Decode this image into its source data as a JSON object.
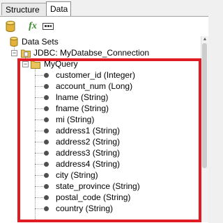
{
  "tabs": [
    {
      "label": "Structure",
      "active": false
    },
    {
      "label": "Data",
      "active": true
    }
  ],
  "toolbar": {
    "icons": [
      "database-icon",
      "function-icon",
      "parameter-icon"
    ],
    "fx_label": "fx"
  },
  "tree": {
    "root_label": "Data Sets",
    "connection_label": "JDBC: MyDatabse_Connection",
    "query_label": "MyQuery",
    "columns": [
      "customer_id (Integer)",
      "account_num (Long)",
      "lname (String)",
      "fname (String)",
      "mi (String)",
      "address1 (String)",
      "address2 (String)",
      "address3 (String)",
      "address4 (String)",
      "city (String)",
      "state_province (String)",
      "postal_code (String)",
      "country (String)"
    ]
  },
  "colors": {
    "highlight_border": "#e01b24",
    "folder": "#e8c35c",
    "database": "#d9a520"
  }
}
